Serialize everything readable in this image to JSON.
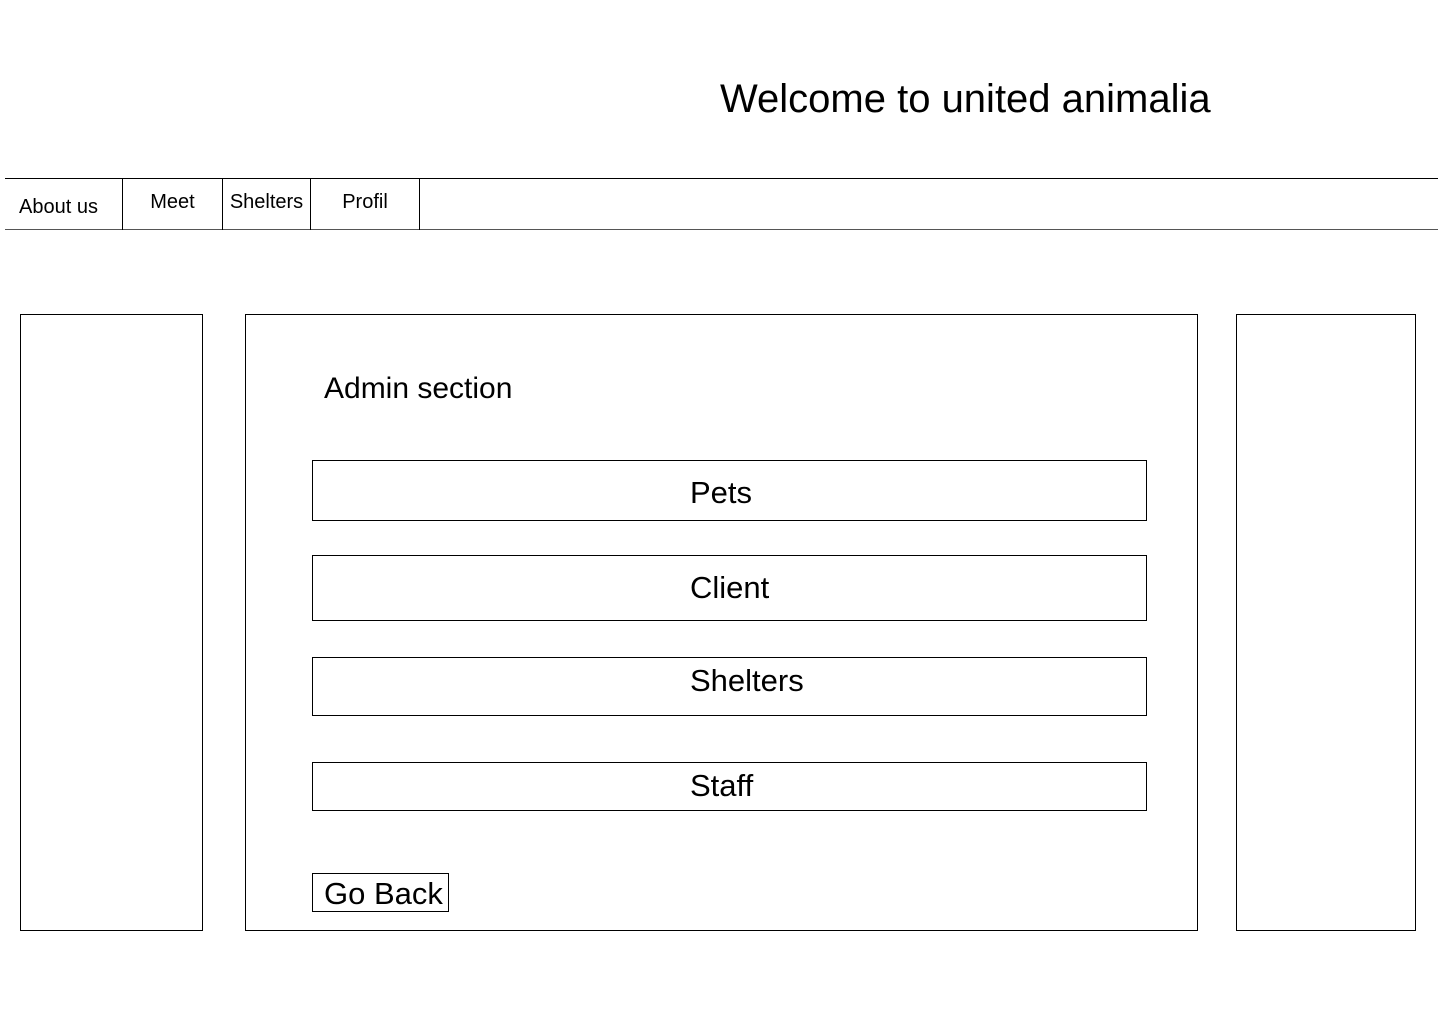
{
  "header": {
    "title": "Welcome to united animalia"
  },
  "nav": {
    "items": [
      {
        "label": "About us"
      },
      {
        "label": "Meet"
      },
      {
        "label": "Shelters"
      },
      {
        "label": "Profil"
      }
    ]
  },
  "admin": {
    "title": "Admin section",
    "buttons": [
      {
        "label": "Pets"
      },
      {
        "label": "Client"
      },
      {
        "label": "Shelters"
      },
      {
        "label": "Staff"
      }
    ],
    "back_label": "Go Back"
  }
}
